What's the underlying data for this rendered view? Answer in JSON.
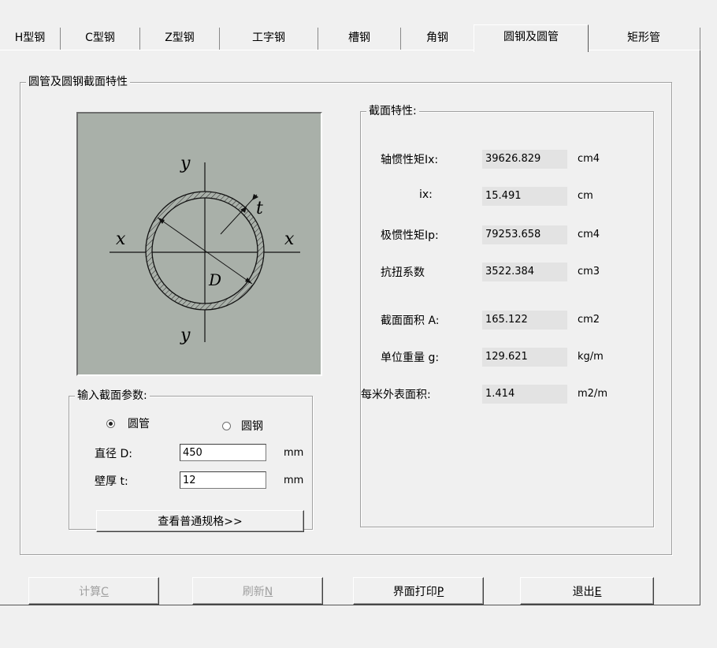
{
  "tabs": [
    {
      "label": "H型钢"
    },
    {
      "label": "C型钢"
    },
    {
      "label": "Z型钢"
    },
    {
      "label": "工字钢"
    },
    {
      "label": "槽钢"
    },
    {
      "label": "角钢"
    },
    {
      "label": "圆钢及圆管",
      "active": true
    },
    {
      "label": "矩形管"
    }
  ],
  "section_group": {
    "title": "圆管及圆钢截面特性"
  },
  "figure": {
    "axis_y": "y",
    "axis_x": "x",
    "label_t": "t",
    "label_d": "D"
  },
  "results": {
    "title": "截面特性:",
    "rows": [
      {
        "label": "轴惯性矩Ix:",
        "value": "39626.829",
        "unit": "cm4"
      },
      {
        "label": "ix:",
        "value": "15.491",
        "unit": "cm"
      },
      {
        "label": "极惯性矩Ip:",
        "value": "79253.658",
        "unit": "cm4"
      },
      {
        "label": "抗扭系数",
        "value": "3522.384",
        "unit": "cm3"
      },
      {
        "label": "截面面积 A:",
        "value": "165.122",
        "unit": "cm2"
      },
      {
        "label": "单位重量 g:",
        "value": "129.621",
        "unit": "kg/m"
      },
      {
        "label": "每米外表面积:",
        "value": "1.414",
        "unit": "m2/m"
      }
    ]
  },
  "input_group": {
    "title": "输入截面参数:",
    "radio_pipe": "圆管",
    "radio_bar": "圆钢",
    "selected": "圆管",
    "diameter_label": "直径 D:",
    "diameter_value": "450",
    "diameter_unit": "mm",
    "thickness_label": "壁厚 t:",
    "thickness_value": "12",
    "thickness_unit": "mm",
    "spec_button": "查看普通规格>>"
  },
  "buttons": {
    "calc": "计算",
    "calc_key": "C",
    "refresh": "刷新",
    "refresh_key": "N",
    "print": "界面打印",
    "print_key": "P",
    "exit": "退出",
    "exit_key": "E"
  }
}
